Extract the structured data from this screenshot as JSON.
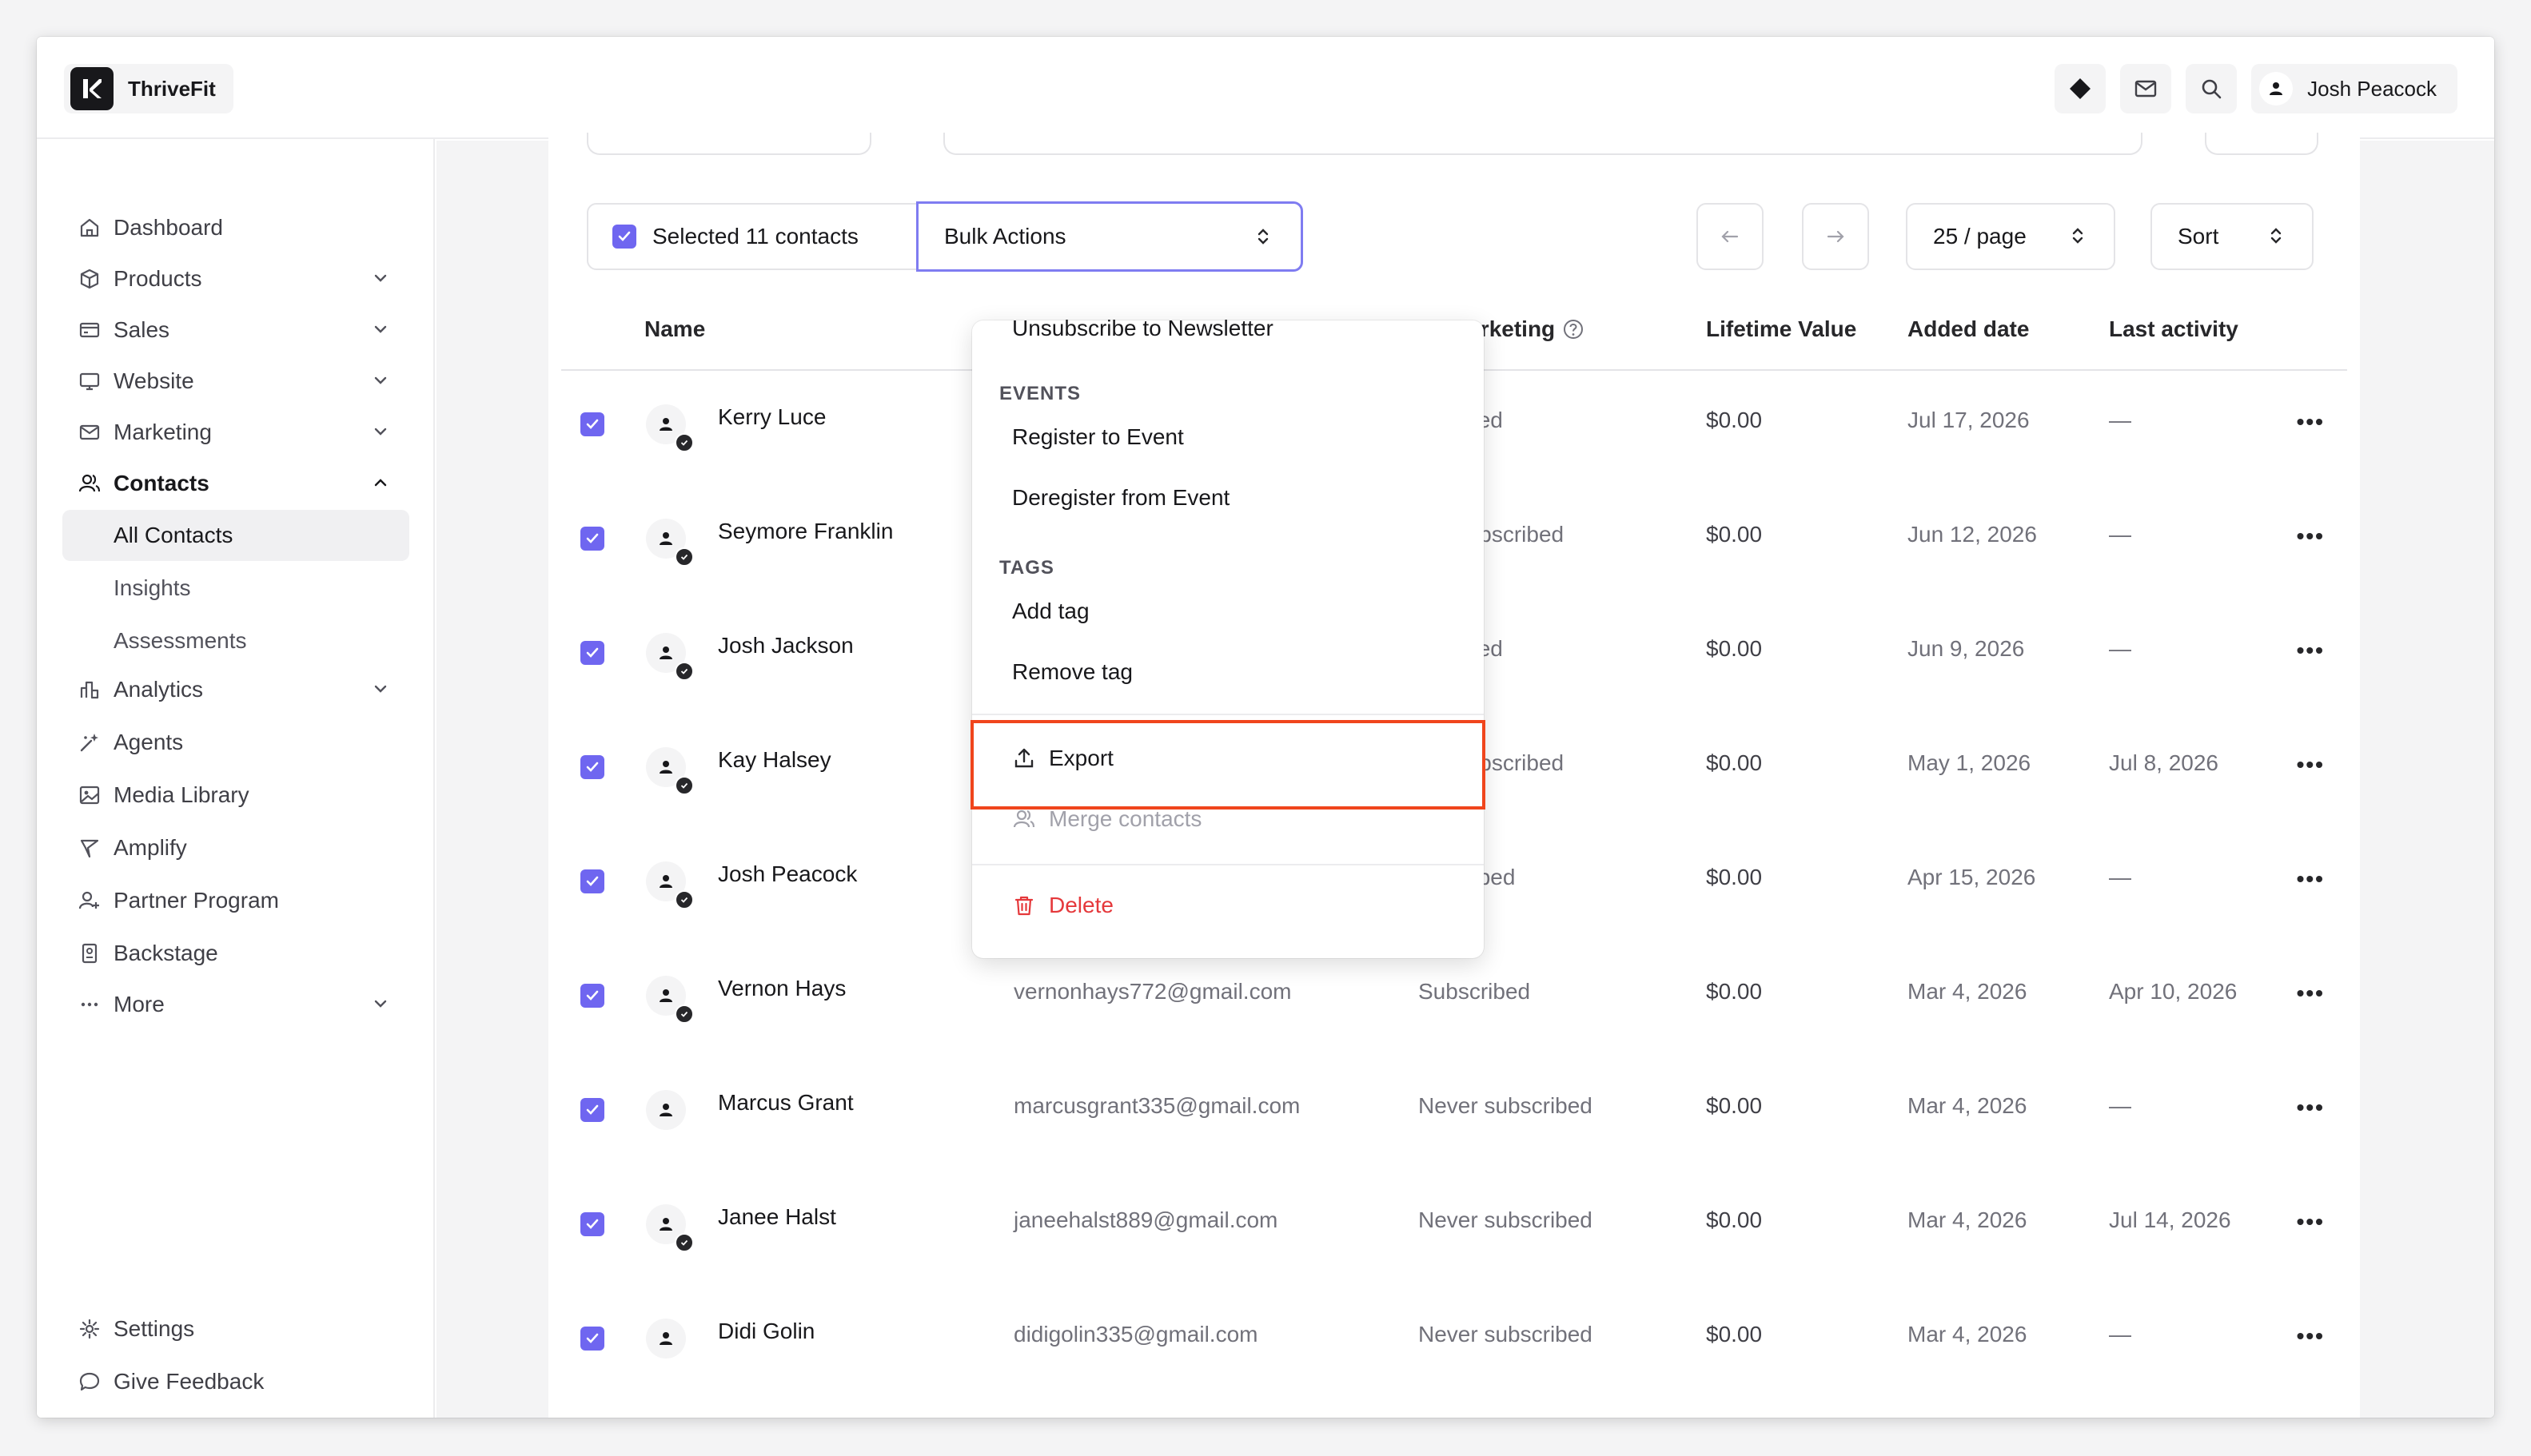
{
  "app": {
    "name": "ThriveFit"
  },
  "header": {
    "user_name": "Josh Peacock"
  },
  "sidebar": {
    "items": [
      {
        "label": "Dashboard"
      },
      {
        "label": "Products"
      },
      {
        "label": "Sales"
      },
      {
        "label": "Website"
      },
      {
        "label": "Marketing"
      },
      {
        "label": "Contacts"
      },
      {
        "label": "Analytics"
      },
      {
        "label": "Agents"
      },
      {
        "label": "Media Library"
      },
      {
        "label": "Amplify"
      },
      {
        "label": "Partner Program"
      },
      {
        "label": "Backstage"
      },
      {
        "label": "More"
      }
    ],
    "contacts_sub": [
      {
        "label": "All Contacts"
      },
      {
        "label": "Insights"
      },
      {
        "label": "Assessments"
      }
    ],
    "footer": [
      {
        "label": "Settings"
      },
      {
        "label": "Give Feedback"
      }
    ]
  },
  "toolbar": {
    "selected_label": "Selected 11 contacts",
    "bulk_actions_label": "Bulk Actions",
    "page_size": "25 / page",
    "sort_label": "Sort"
  },
  "table": {
    "columns": [
      "Name",
      "ail Marketing",
      "Lifetime Value",
      "Added date",
      "Last activity"
    ],
    "rows": [
      {
        "name": "Kerry Luce",
        "email": "",
        "marketing": "bscribed",
        "value": "$0.00",
        "added": "Jul 17, 2026",
        "last": "—"
      },
      {
        "name": "Seymore Franklin",
        "email": "",
        "marketing": "ver subscribed",
        "value": "$0.00",
        "added": "Jun 12, 2026",
        "last": "—"
      },
      {
        "name": "Josh Jackson",
        "email": "",
        "marketing": "bscribed",
        "value": "$0.00",
        "added": "Jun 9, 2026",
        "last": "—"
      },
      {
        "name": "Kay Halsey",
        "email": "",
        "marketing": "ver subscribed",
        "value": "$0.00",
        "added": "May 1, 2026",
        "last": "Jul 8, 2026"
      },
      {
        "name": "Josh Peacock",
        "email": "",
        "marketing": "ubscribed",
        "value": "$0.00",
        "added": "Apr 15, 2026",
        "last": "—"
      },
      {
        "name": "Vernon Hays",
        "email": "vernonhays772@gmail.com",
        "marketing": "Subscribed",
        "value": "$0.00",
        "added": "Mar 4, 2026",
        "last": "Apr 10, 2026"
      },
      {
        "name": "Marcus Grant",
        "email": "marcusgrant335@gmail.com",
        "marketing": "Never subscribed",
        "value": "$0.00",
        "added": "Mar 4, 2026",
        "last": "—"
      },
      {
        "name": "Janee Halst",
        "email": "janeehalst889@gmail.com",
        "marketing": "Never subscribed",
        "value": "$0.00",
        "added": "Mar 4, 2026",
        "last": "Jul 14, 2026"
      },
      {
        "name": "Didi Golin",
        "email": "didigolin335@gmail.com",
        "marketing": "Never subscribed",
        "value": "$0.00",
        "added": "Mar 4, 2026",
        "last": "—"
      }
    ]
  },
  "dropdown": {
    "top_item": "Unsubscribe to Newsletter",
    "events_header": "EVENTS",
    "register": "Register to Event",
    "deregister": "Deregister from Event",
    "tags_header": "TAGS",
    "add_tag": "Add tag",
    "remove_tag": "Remove tag",
    "export": "Export",
    "merge": "Merge contacts",
    "delete": "Delete"
  },
  "colors": {
    "accent": "#6f66f0",
    "danger": "#e5383b",
    "highlight": "#f0451c"
  }
}
